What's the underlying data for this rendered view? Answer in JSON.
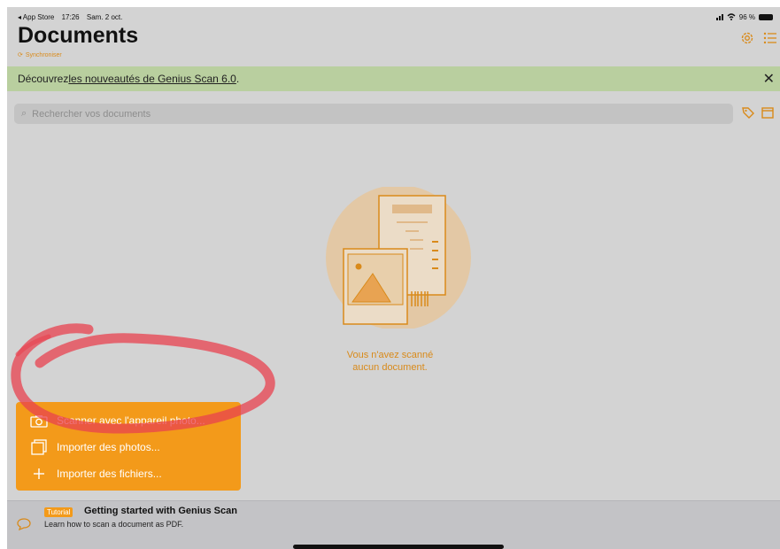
{
  "statusbar": {
    "back_app": "◂ App Store",
    "time": "17:26",
    "date": "Sam. 2 oct.",
    "battery": "96 %"
  },
  "header": {
    "title": "Documents",
    "sync_label": "Synchroniser"
  },
  "banner": {
    "prefix": "Découvrez ",
    "link": "les nouveautés de Genius Scan 6.0",
    "suffix": ".",
    "close": "✕"
  },
  "search": {
    "placeholder": "Rechercher vos documents"
  },
  "empty_state": {
    "line1": "Vous n'avez scanné",
    "line2": "aucun document."
  },
  "menu": {
    "items": [
      {
        "label": "Scanner avec l'appareil photo...",
        "icon": "camera-icon"
      },
      {
        "label": "Importer des photos...",
        "icon": "photos-icon"
      },
      {
        "label": "Importer des fichiers...",
        "icon": "plus-icon"
      }
    ]
  },
  "tutorial": {
    "tag": "Tutorial",
    "title": "Getting started with Genius Scan",
    "subtitle": "Learn how to scan a document as PDF."
  },
  "colors": {
    "accent": "#f39a1a",
    "banner_bg": "#b9cf9f",
    "background": "#d3d3d3",
    "annotation": "#e8414f"
  }
}
